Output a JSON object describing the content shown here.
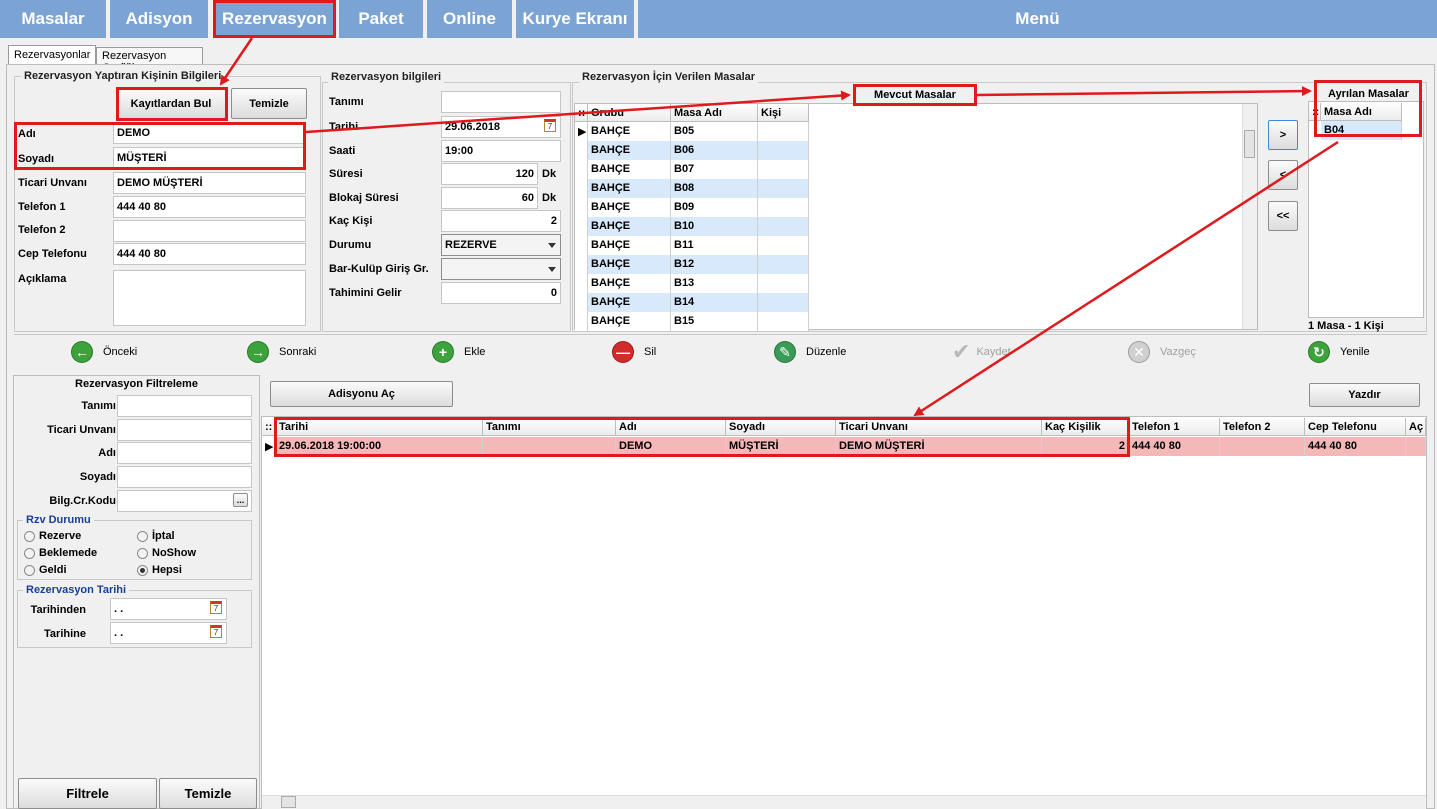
{
  "nav": {
    "masalar": "Masalar",
    "adisyon": "Adisyon",
    "rezervasyon": "Rezervasyon",
    "paket": "Paket",
    "online": "Online",
    "kurye": "Kurye Ekranı",
    "menu": "Menü"
  },
  "tabs": {
    "rezervasyonlar": "Rezervasyonlar",
    "grafik": "Rezervasyon Grafiği"
  },
  "customer": {
    "title": "Rezervasyon Yaptıran Kişinin Bilgileri",
    "find_btn": "Kayıtlardan Bul",
    "clear_btn": "Temizle",
    "ad_label": "Adı",
    "ad_value": "DEMO",
    "soyad_label": "Soyadı",
    "soyad_value": "MÜŞTERİ",
    "ticari_label": "Ticari Unvanı",
    "ticari_value": "DEMO MÜŞTERİ",
    "tel1_label": "Telefon 1",
    "tel1_value": "444 40 80",
    "tel2_label": "Telefon 2",
    "tel2_value": "",
    "cep_label": "Cep Telefonu",
    "cep_value": "444 40 80",
    "aciklama_label": "Açıklama",
    "aciklama_value": ""
  },
  "reservation": {
    "title": "Rezervasyon bilgileri",
    "tanim_label": "Tanımı",
    "tanim_value": "",
    "tarih_label": "Tarihi",
    "tarih_value": "29.06.2018",
    "saat_label": "Saati",
    "saat_value": "19:00",
    "sure_label": "Süresi",
    "sure_value": "120",
    "sure_unit": "Dk",
    "blokaj_label": "Blokaj Süresi",
    "blokaj_value": "60",
    "blokaj_unit": "Dk",
    "kisi_label": "Kaç Kişi",
    "kisi_value": "2",
    "durum_label": "Durumu",
    "durum_value": "REZERVE",
    "bar_label": "Bar-Kulüp Giriş Gr.",
    "bar_value": "",
    "gelir_label": "Tahimini Gelir",
    "gelir_value": "0"
  },
  "tables": {
    "title": "Rezervasyon İçin Verilen Masalar",
    "mevcut_label": "Mevcut Masalar",
    "columns": [
      "Grubu",
      "Masa Adı",
      "Kişi"
    ],
    "rows": [
      [
        "BAHÇE",
        "B05",
        ""
      ],
      [
        "BAHÇE",
        "B06",
        ""
      ],
      [
        "BAHÇE",
        "B07",
        ""
      ],
      [
        "BAHÇE",
        "B08",
        ""
      ],
      [
        "BAHÇE",
        "B09",
        ""
      ],
      [
        "BAHÇE",
        "B10",
        ""
      ],
      [
        "BAHÇE",
        "B11",
        ""
      ],
      [
        "BAHÇE",
        "B12",
        ""
      ],
      [
        "BAHÇE",
        "B13",
        ""
      ],
      [
        "BAHÇE",
        "B14",
        ""
      ],
      [
        "BAHÇE",
        "B15",
        ""
      ]
    ],
    "move_right": ">",
    "move_left": "<",
    "move_all_left": "<<",
    "ayrilan_label": "Ayrılan Masalar",
    "ayrilan_column": "Masa Adı",
    "ayrilan_rows": [
      "B04"
    ],
    "summary": "1 Masa - 1 Kişi"
  },
  "toolbar": {
    "onceki": "Önceki",
    "sonraki": "Sonraki",
    "ekle": "Ekle",
    "sil": "Sil",
    "duzenle": "Düzenle",
    "kaydet": "Kaydet",
    "vazgec": "Vazgeç",
    "yenile": "Yenile"
  },
  "filter": {
    "title": "Rezervasyon Filtreleme",
    "tanim_label": "Tanımı",
    "ticari_label": "Ticari Unvanı",
    "adi_label": "Adı",
    "soyadi_label": "Soyadı",
    "bilg_label": "Bilg.Cr.Kodu",
    "bilg_btn": "...",
    "durum_title": "Rzv Durumu",
    "r_rezerve": "Rezerve",
    "r_iptal": "İptal",
    "r_beklemede": "Beklemede",
    "r_noshow": "NoShow",
    "r_geldi": "Geldi",
    "r_hepsi": "Hepsi",
    "tarih_title": "Rezervasyon Tarihi",
    "tarihinden_label": "Tarihinden",
    "tarihinden_value": ". .",
    "tarihine_label": "Tarihine",
    "tarihine_value": ". .",
    "filtrele_btn": "Filtrele",
    "temizle_btn": "Temizle"
  },
  "list": {
    "adisyon_btn": "Adisyonu Aç",
    "yazdir_btn": "Yazdır",
    "columns": [
      "Tarihi",
      "Tanımı",
      "Adı",
      "Soyadı",
      "Ticari Unvanı",
      "Kaç Kişilik",
      "Telefon 1",
      "Telefon 2",
      "Cep Telefonu",
      "Aç"
    ],
    "row": [
      "29.06.2018 19:00:00",
      "",
      "DEMO",
      "MÜŞTERİ",
      "DEMO MÜŞTERİ",
      "2",
      "444 40 80",
      "",
      "444 40 80",
      ""
    ]
  },
  "colors": {
    "nav_bg": "#7ba3d4",
    "highlight_red": "#e0191c",
    "row_pink": "#f4b8b8",
    "row_blue": "#d7e9fb"
  }
}
